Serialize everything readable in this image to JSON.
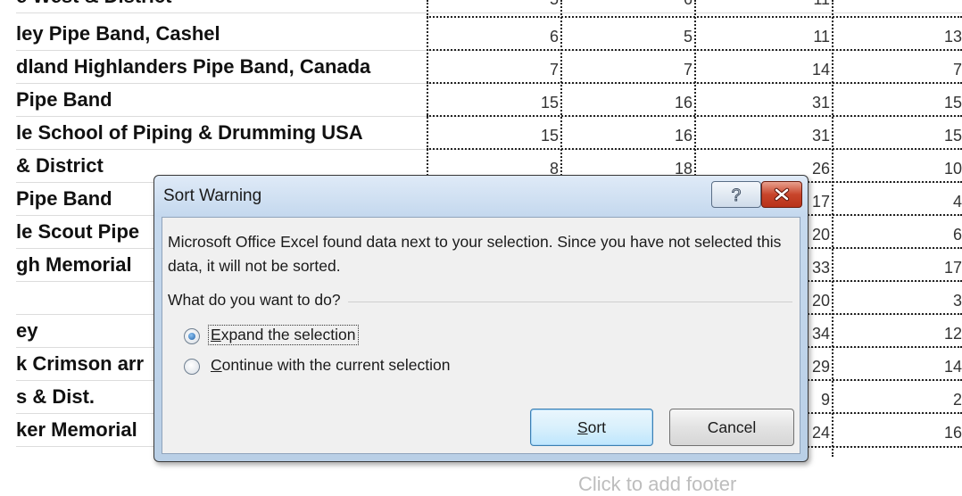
{
  "sheet": {
    "partial_top_row": {
      "name": "e West & District",
      "c1": "5",
      "c2": "6",
      "c3": "11",
      "c4": ""
    },
    "rows": [
      {
        "name": "ley Pipe Band, Cashel",
        "c1": "6",
        "c2": "5",
        "c3": "11",
        "c4": "13"
      },
      {
        "name": "dland Highlanders Pipe Band, Canada",
        "c1": "7",
        "c2": "7",
        "c3": "14",
        "c4": "7"
      },
      {
        "name": "Pipe Band",
        "c1": "15",
        "c2": "16",
        "c3": "31",
        "c4": "15"
      },
      {
        "name": "le School of Piping & Drumming USA",
        "c1": "15",
        "c2": "16",
        "c3": "31",
        "c4": "15"
      },
      {
        "name": "& District",
        "c1": "8",
        "c2": "18",
        "c3": "26",
        "c4": "10"
      },
      {
        "name": "Pipe Band",
        "c1": "",
        "c2": "",
        "c3": "17",
        "c4": "4"
      },
      {
        "name": "le Scout Pipe",
        "c1": "",
        "c2": "",
        "c3": "20",
        "c4": "6"
      },
      {
        "name": "gh Memorial",
        "c1": "",
        "c2": "",
        "c3": "33",
        "c4": "17"
      },
      {
        "name": "",
        "c1": "",
        "c2": "",
        "c3": "20",
        "c4": "3"
      },
      {
        "name": "ey",
        "c1": "",
        "c2": "",
        "c3": "34",
        "c4": "12"
      },
      {
        "name": "k Crimson arr",
        "c1": "",
        "c2": "",
        "c3": "29",
        "c4": "14"
      },
      {
        "name": "s & Dist.",
        "c1": "",
        "c2": "",
        "c3": "9",
        "c4": "2"
      },
      {
        "name": "ker Memorial",
        "c1": "",
        "c2": "",
        "c3": "24",
        "c4": "16"
      }
    ],
    "footer_placeholder": "Click to add footer"
  },
  "dialog": {
    "title": "Sort Warning",
    "help_icon": "question-mark-icon",
    "close_icon": "close-x-icon",
    "message": "Microsoft Office Excel found data next to your selection.  Since you have not selected this data, it will not be sorted.",
    "question": "What do you want to do?",
    "options": [
      {
        "pre": "",
        "accel": "E",
        "post": "xpand the selection",
        "selected": true
      },
      {
        "pre": "",
        "accel": "C",
        "post": "ontinue with the current selection",
        "selected": false
      }
    ],
    "sort_button": {
      "accel": "S",
      "post": "ort"
    },
    "cancel_button": "Cancel",
    "colors": {
      "close_red": "#c8452b",
      "titlebar": "#c4d8ee",
      "client_bg": "#f0f0f0"
    }
  }
}
